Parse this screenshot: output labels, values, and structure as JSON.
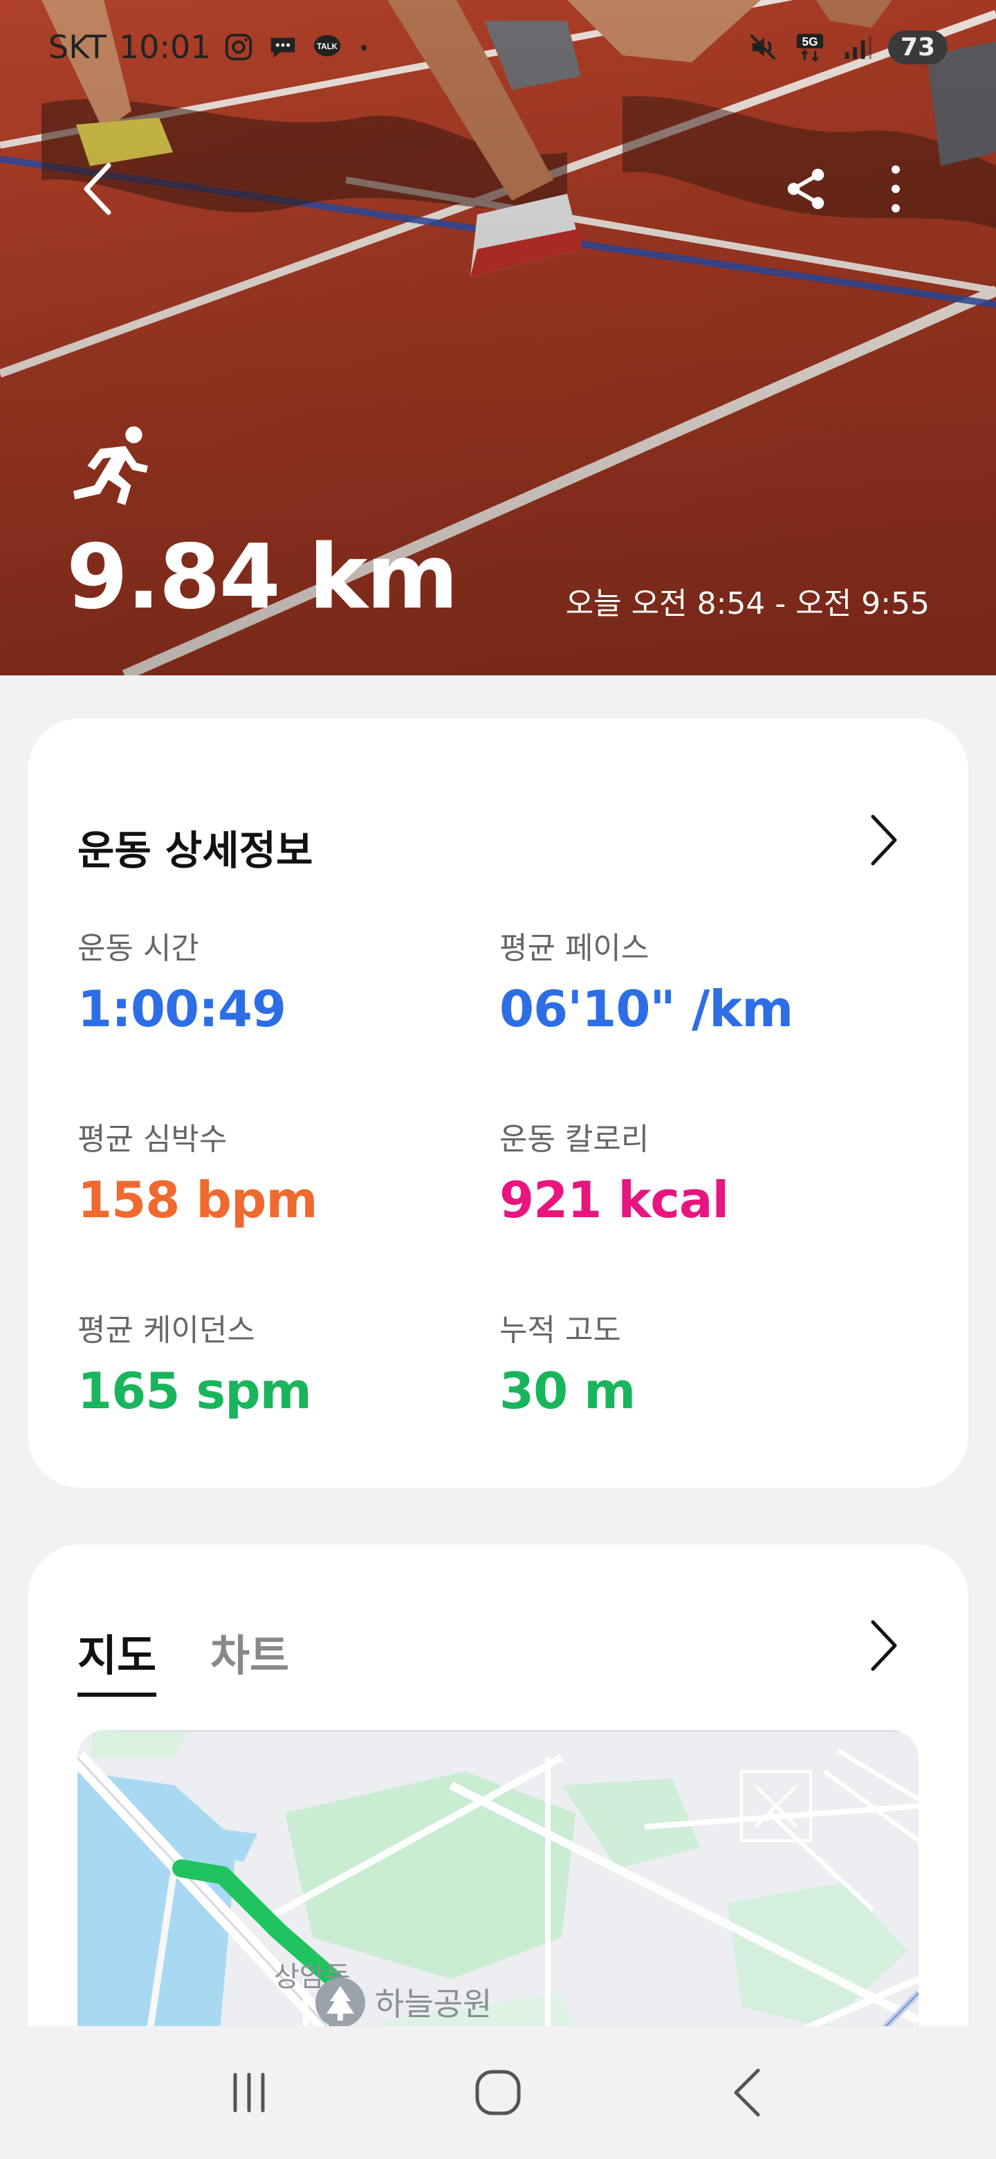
{
  "status_bar": {
    "carrier": "SKT",
    "time": "10:01",
    "battery": "73",
    "icons": [
      "instagram-icon",
      "chat-icon",
      "kakaotalk-icon",
      "dot-icon",
      "mute-icon",
      "5g-icon",
      "signal-icon",
      "battery-icon"
    ]
  },
  "header": {
    "back_icon": "back-chevron-icon",
    "share_icon": "share-icon",
    "more_icon": "more-vertical-icon"
  },
  "summary": {
    "activity_icon": "running-icon",
    "distance": "9.84 km",
    "time_range": "오늘 오전 8:54 - 오전 9:55"
  },
  "details": {
    "title": "운동 상세정보",
    "stats": [
      {
        "label": "운동 시간",
        "value": "1:00:49",
        "color": "#2d6ee6"
      },
      {
        "label": "평균 페이스",
        "value": "06'10\" /km",
        "color": "#2d6ee6"
      },
      {
        "label": "평균 심박수",
        "value": "158 bpm",
        "color": "#f0692e"
      },
      {
        "label": "운동 칼로리",
        "value": "921 kcal",
        "color": "#e8157e"
      },
      {
        "label": "평균 케이던스",
        "value": "165 spm",
        "color": "#19b55c"
      },
      {
        "label": "누적 고도",
        "value": "30 m",
        "color": "#19b55c"
      }
    ]
  },
  "map_section": {
    "tabs": [
      {
        "label": "지도",
        "active": true
      },
      {
        "label": "차트",
        "active": false
      }
    ],
    "map_labels": {
      "district": "상암동",
      "park": "하늘공원"
    }
  },
  "navbar": {
    "recents_icon": "recents-icon",
    "home_icon": "home-icon",
    "back_icon": "nav-back-icon"
  },
  "colors": {
    "blue": "#2d6ee6",
    "orange": "#f0692e",
    "pink": "#e8157e",
    "green": "#19b55c",
    "route": "#1fc45e"
  }
}
